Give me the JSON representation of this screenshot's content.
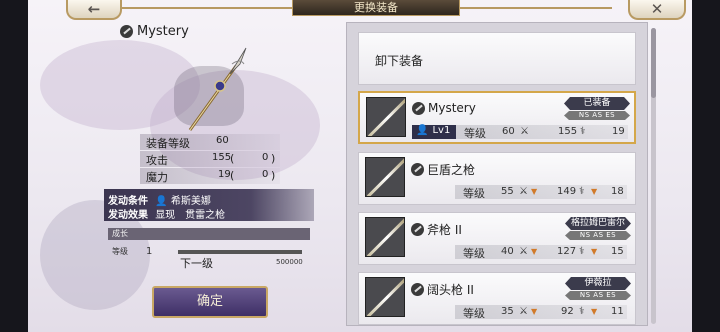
{
  "header": {
    "title": "更换装备",
    "back_icon": "←",
    "close_icon": "✕"
  },
  "detail": {
    "weapon_name": "Mystery",
    "stats": [
      {
        "label": "装备等级",
        "value": "60",
        "extra": ""
      },
      {
        "label": "攻击",
        "value": "155",
        "extra": "0"
      },
      {
        "label": "魔力",
        "value": "19",
        "extra": "0"
      }
    ],
    "skill_trigger_label": "发动条件",
    "skill_trigger_value": "希斯美娜",
    "skill_effect_label": "发动效果",
    "skill_effect_value": "显现　贯雷之枪",
    "growth_label": "成长",
    "growth_level_label": "等级",
    "growth_level": "1",
    "next_level_label": "下一级",
    "next_level_value": "500000",
    "confirm_label": "确定"
  },
  "list": {
    "unequip_label": "卸下装备",
    "stat_label": "等级",
    "items": [
      {
        "name": "Mystery",
        "lv": "Lv1",
        "level": "60",
        "attack": "155",
        "magic": "19",
        "equipped_by": "已装备",
        "tribes": "NS AS ES",
        "selected": true
      },
      {
        "name": "巨盾之枪",
        "lv": "",
        "level": "55",
        "attack": "149",
        "magic": "18",
        "equipped_by": "",
        "tribes": "",
        "selected": false
      },
      {
        "name": "斧枪 II",
        "lv": "",
        "level": "40",
        "attack": "127",
        "magic": "15",
        "equipped_by": "格拉姆巴雷尔",
        "tribes": "NS AS ES",
        "selected": false
      },
      {
        "name": "阔头枪 II",
        "lv": "",
        "level": "35",
        "attack": "92",
        "magic": "11",
        "equipped_by": "伊薇拉",
        "tribes": "NS AS ES",
        "selected": false
      }
    ]
  }
}
